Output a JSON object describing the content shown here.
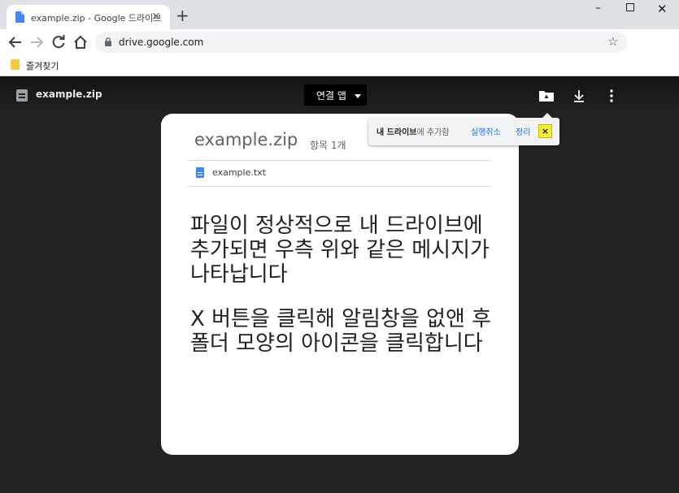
{
  "browser": {
    "tab_title": "example.zip - Google 드라이브",
    "url": "drive.google.com",
    "bookmark_label": "즐겨찾기"
  },
  "viewer": {
    "filename": "example.zip",
    "open_with_label": "연결 앱"
  },
  "card": {
    "zip_name": "example.zip",
    "item_count": "항목 1개",
    "entries": [
      "example.txt"
    ],
    "message": [
      "파일이 정상적으로 내 드라이브에",
      "추가되면 우측 위와 같은 메시지가",
      "나타납니다",
      "X 버튼을 클릭해 알림창을 없앤 후",
      "폴더 모양의 아이콘을 클릭합니다"
    ]
  },
  "toast": {
    "bold_text": "내 드라이브",
    "text": "에 추가함",
    "undo_label": "실행취소",
    "organize_label": "정리",
    "close_label": "×"
  },
  "colors": {
    "drive_blue": "#1a73e8",
    "doc_blue": "#4285f4",
    "highlight": "#f5ee34"
  }
}
